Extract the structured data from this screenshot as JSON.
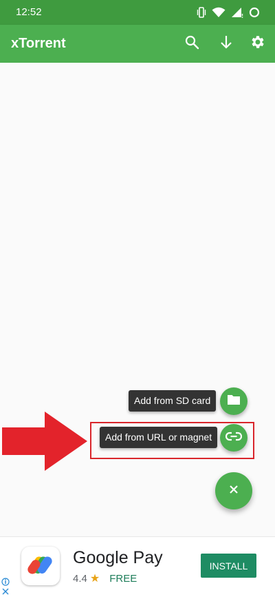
{
  "status_bar": {
    "time": "12:52",
    "icons": [
      "vibrate-icon",
      "wifi-icon",
      "signal-icon",
      "battery-ring-icon"
    ]
  },
  "app_bar": {
    "title": "xTorrent",
    "actions": [
      "search-icon",
      "arrow-down-icon",
      "gear-icon"
    ]
  },
  "speed_dial": {
    "sd_card_label": "Add from SD card",
    "url_magnet_label": "Add from URL or magnet",
    "sd_card_icon": "folder-icon",
    "url_magnet_icon": "link-icon",
    "main_fab_icon": "close-icon"
  },
  "annotation": {
    "color": "#d9252b"
  },
  "ad": {
    "app_name": "Google Pay",
    "rating": "4.4",
    "price": "FREE",
    "install_label": "INSTALL",
    "accent_color": "#1e8c63"
  },
  "colors": {
    "primary": "#4caf50",
    "primary_dark": "#3f9b3f",
    "label_bg": "#333333"
  }
}
